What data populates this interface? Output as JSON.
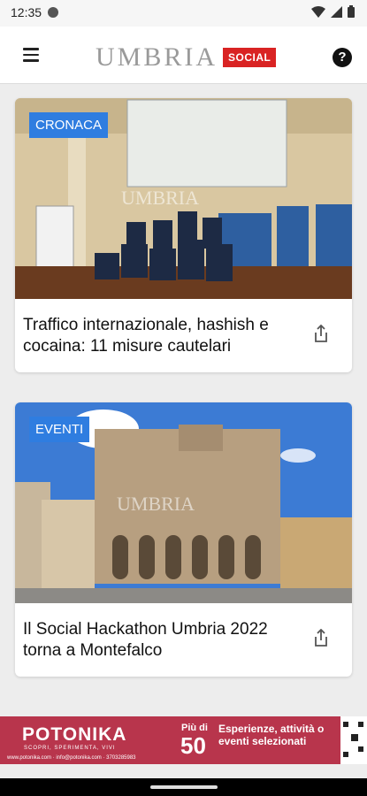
{
  "status": {
    "time": "12:35"
  },
  "header": {
    "logo_text": "UMBRIA",
    "logo_badge": "SOCIAL"
  },
  "articles": [
    {
      "category": "CRONACA",
      "title": "Traffico internazionale, hashish e cocaina: 11 misure cautelari"
    },
    {
      "category": "EVENTI",
      "title": "Il Social Hackathon Umbria 2022 torna a Montefalco"
    }
  ],
  "ad": {
    "brand": "POTONIKA",
    "tagline": "SCOPRI, SPERIMENTA, VIVI",
    "contact": "www.potonika.com · info@potonika.com · 3703285983",
    "piu_di": "Più di",
    "number": "50",
    "description": "Esperienze, attività o eventi selezionati"
  },
  "colors": {
    "accent": "#2f7de0",
    "logo_badge": "#d92323",
    "ad_background": "#b8354c"
  }
}
